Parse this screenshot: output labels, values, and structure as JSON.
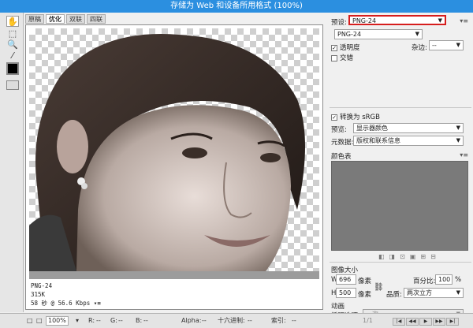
{
  "window": {
    "title": "存储为 Web 和设备所用格式 (100%)"
  },
  "tabs": [
    {
      "label": "原稿"
    },
    {
      "label": "优化"
    },
    {
      "label": "双联"
    },
    {
      "label": "四联"
    }
  ],
  "preview": {
    "format": "PNG-24",
    "size": "315K",
    "time": "58 秒 @ 56.6 Kbps"
  },
  "statusbar": {
    "zoom": "100%",
    "r_label": "R:",
    "g_label": "G:",
    "b_label": "B:",
    "alpha_label": "Alpha:",
    "hex_label": "十六进制:",
    "index_label": "索引:",
    "r_value": "--",
    "g_value": "--",
    "b_value": "--",
    "alpha_value": "--",
    "hex_value": "--",
    "index_value": "--"
  },
  "settings": {
    "preset_label": "预设:",
    "preset_value": "PNG-24",
    "format_value": "PNG-24",
    "transparency_label": "透明度",
    "interlaced_label": "交错",
    "matte_label": "杂边:",
    "matte_value": "--",
    "transparency_checked": true,
    "interlaced_checked": false
  },
  "color": {
    "convert_srgb_label": "转换为 sRGB",
    "convert_srgb_checked": true,
    "preview_label": "预览:",
    "preview_value": "显示器颜色",
    "metadata_label": "元数据:",
    "metadata_value": "版权和联系信息",
    "color_table_label": "颜色表"
  },
  "image_size": {
    "section_label": "图像大小",
    "w_label": "W:",
    "w_value": "696",
    "h_label": "H:",
    "h_value": "500",
    "pixel_unit": "像素",
    "percent_label": "百分比:",
    "percent_value": "100",
    "percent_unit": "%",
    "quality_label": "品质:",
    "quality_value": "两次立方"
  },
  "animation": {
    "section_label": "动画",
    "loop_label": "循环选项:",
    "loop_value": "一次",
    "frame_counter": "1/1"
  },
  "colors": {
    "titlebar": "#2b8fe0",
    "preset_highlight": "#d61d1d",
    "color_table": "#7a7a7a"
  },
  "icons": [
    "hand-icon",
    "slice-select-icon",
    "zoom-icon",
    "eyedropper-icon"
  ]
}
